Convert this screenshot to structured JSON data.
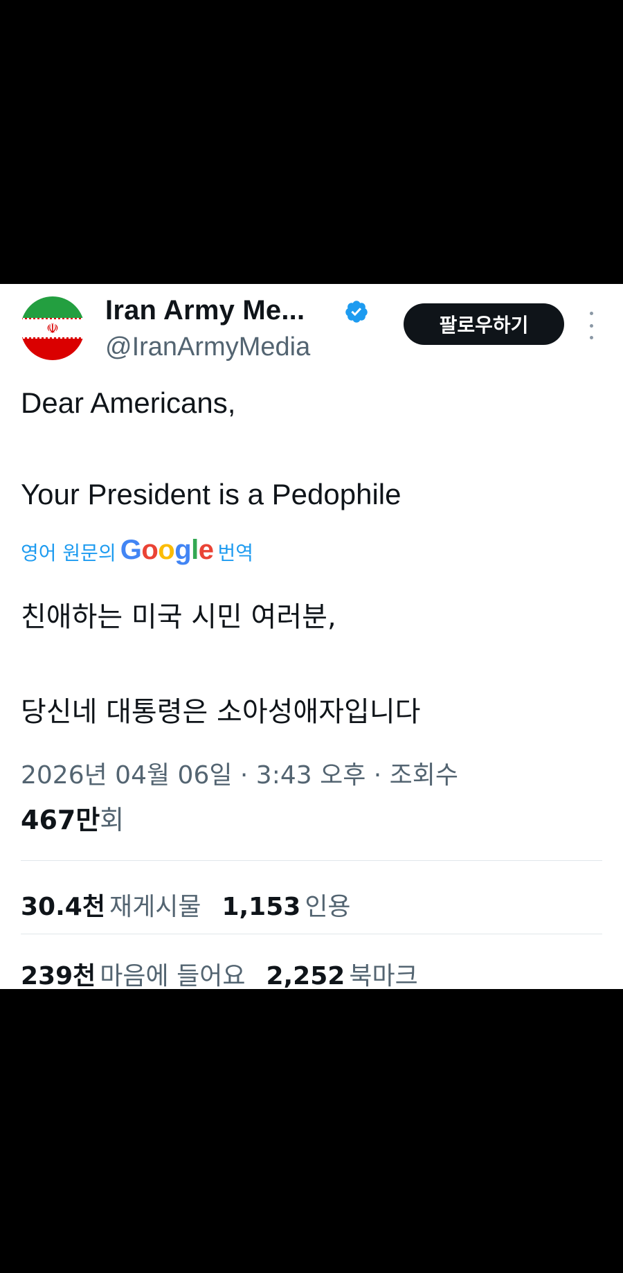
{
  "account": {
    "display_name": "Iran Army Me...",
    "handle": "@IranArmyMedia",
    "verified_icon": "verified-badge-icon",
    "follow_label": "팔로우하기",
    "more_icon": "more-options-icon",
    "avatar_emblem": "☫"
  },
  "tweet": {
    "line1": "Dear Americans,",
    "line2": "Your President is a Pedophile",
    "translation_prefix": "영어 원문의",
    "translation_brand": "Google",
    "translation_suffix": "번역",
    "translated_line1": "친애하는 미국 시민 여러분,",
    "translated_line2": "당신네 대통령은 소아성애자입니다"
  },
  "meta": {
    "timestamp": "2026년 04월 06일 · 3:43 오후 · 조회수",
    "views_number": "467만",
    "views_unit": "회"
  },
  "stats": {
    "reposts_count": "30.4천",
    "reposts_label": "재게시물",
    "quotes_count": "1,153",
    "quotes_label": "인용",
    "likes_count": "239천",
    "likes_label": "마음에 들어요",
    "bookmarks_count": "2,252",
    "bookmarks_label": "북마크"
  },
  "colors": {
    "link_blue": "#1d9bf0",
    "secondary_text": "#536471",
    "primary_text": "#0f1419",
    "flag_green": "#239f40",
    "flag_red": "#da0000"
  }
}
